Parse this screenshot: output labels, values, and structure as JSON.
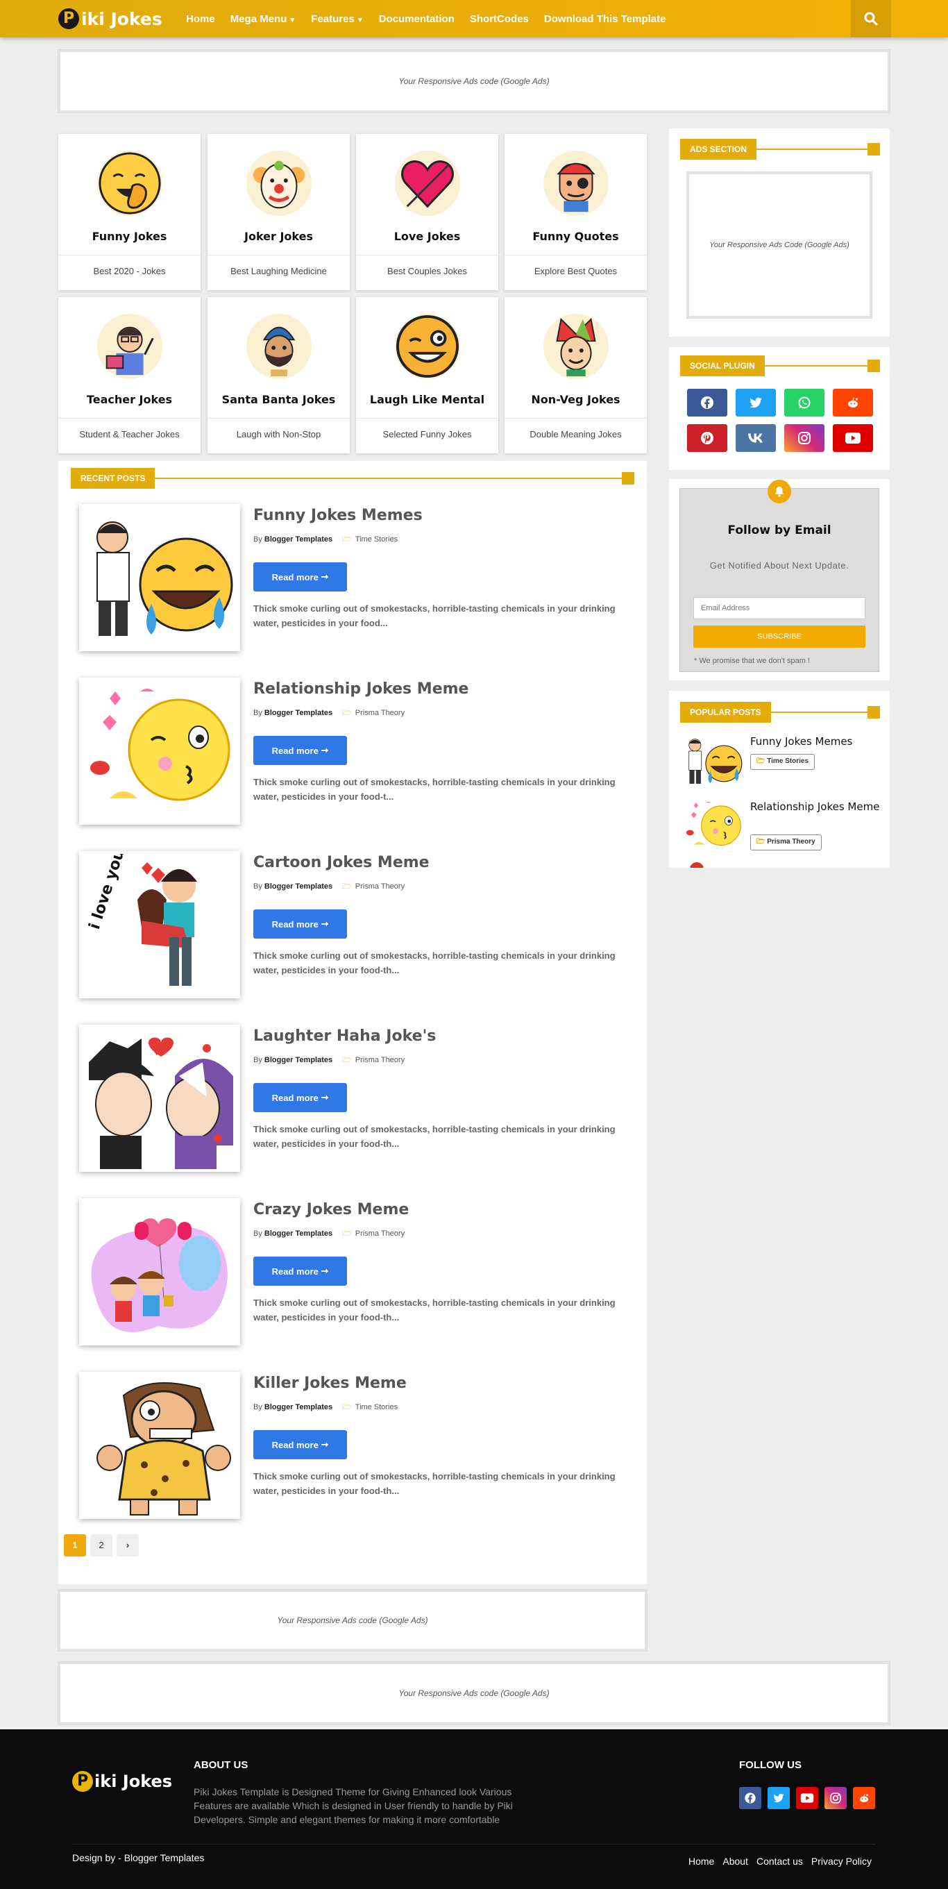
{
  "header": {
    "logo": "Piki Jokes",
    "logo_letter": "P",
    "logo_rest": "iki Jokes",
    "nav": [
      "Home",
      "Mega Menu",
      "Features",
      "Documentation",
      "ShortCodes",
      "Download This Template"
    ],
    "search_icon": "search-icon"
  },
  "ads": {
    "top": "Your Responsive Ads code (Google Ads)",
    "sidebar": "Your Responsive Ads Code (Google Ads)",
    "bottom_main": "Your Responsive Ads code (Google Ads)",
    "bottom_full": "Your Responsive Ads code (Google Ads)"
  },
  "categories": [
    {
      "title": "Funny Jokes",
      "sub": "Best 2020 - Jokes",
      "icon": "laughing-face-icon"
    },
    {
      "title": "Joker Jokes",
      "sub": "Best Laughing Medicine",
      "icon": "clown-icon"
    },
    {
      "title": "Love Jokes",
      "sub": "Best Couples Jokes",
      "icon": "heart-icon"
    },
    {
      "title": "Funny Quotes",
      "sub": "Explore Best Quotes",
      "icon": "pirate-icon"
    },
    {
      "title": "Teacher Jokes",
      "sub": "Student & Teacher Jokes",
      "icon": "teacher-icon"
    },
    {
      "title": "Santa Banta Jokes",
      "sub": "Laugh with Non-Stop",
      "icon": "sikh-man-icon"
    },
    {
      "title": "Laugh Like Mental",
      "sub": "Selected Funny Jokes",
      "icon": "winking-face-icon"
    },
    {
      "title": "Non-Veg Jokes",
      "sub": "Double Meaning Jokes",
      "icon": "jester-icon"
    }
  ],
  "recent": {
    "label": "RECENT POSTS",
    "by": "By",
    "author": "Blogger Templates",
    "read_more": "Read more",
    "posts": [
      {
        "title": "Funny Jokes Memes",
        "label": "Time Stories",
        "excerpt": "Thick smoke curling out of smokestacks, horrible-tasting chemicals in your drinking water, pesticides in your food..."
      },
      {
        "title": "Relationship Jokes Meme",
        "label": "Prisma Theory",
        "excerpt": "Thick smoke curling out of smokestacks, horrible-tasting chemicals in your drinking water, pesticides in your food-t..."
      },
      {
        "title": "Cartoon Jokes Meme",
        "label": "Prisma Theory",
        "excerpt": "Thick smoke curling out of smokestacks, horrible-tasting chemicals in your drinking water, pesticides in your food-th..."
      },
      {
        "title": "Laughter Haha Joke's",
        "label": "Prisma Theory",
        "excerpt": "Thick smoke curling out of smokestacks, horrible-tasting chemicals in your drinking water, pesticides in your food-th..."
      },
      {
        "title": "Crazy Jokes Meme",
        "label": "Prisma Theory",
        "excerpt": "Thick smoke curling out of smokestacks, horrible-tasting chemicals in your drinking water, pesticides in your food-th..."
      },
      {
        "title": "Killer Jokes Meme",
        "label": "Time Stories",
        "excerpt": "Thick smoke curling out of smokestacks, horrible-tasting chemicals in your drinking water, pesticides in your food-th..."
      }
    ],
    "pages": [
      "1",
      "2"
    ],
    "next": "›"
  },
  "sidebar": {
    "ads_label": "ADS SECTION",
    "social_label": "SOCIAL PLUGIN",
    "social": [
      {
        "name": "facebook-icon",
        "glyph": "f",
        "color": "#3b5998"
      },
      {
        "name": "twitter-icon",
        "glyph": "t",
        "color": "#1da1f2"
      },
      {
        "name": "whatsapp-icon",
        "glyph": "w",
        "color": "#25d366"
      },
      {
        "name": "reddit-icon",
        "glyph": "r",
        "color": "#ff4500"
      },
      {
        "name": "pinterest-icon",
        "glyph": "p",
        "color": "#cb2027"
      },
      {
        "name": "vk-icon",
        "glyph": "vk",
        "color": "#4c75a3"
      },
      {
        "name": "instagram-icon",
        "glyph": "ig",
        "color": "#c13584"
      },
      {
        "name": "youtube-icon",
        "glyph": "yt",
        "color": "#e00000"
      }
    ],
    "follow": {
      "title": "Follow by Email",
      "sub": "Get Notified About Next Update.",
      "placeholder": "Email Address",
      "button": "SUBSCRIBE",
      "note": "* We promise that we don't spam !"
    },
    "popular_label": "POPULAR POSTS",
    "popular": [
      {
        "title": "Funny Jokes Memes",
        "label": "Time Stories"
      },
      {
        "title": "Relationship Jokes Meme",
        "label": "Prisma Theory"
      }
    ]
  },
  "footer": {
    "logo": "Piki Jokes",
    "about_title": "ABOUT US",
    "about_text": "Piki Jokes Template is Designed Theme for Giving Enhanced look Various Features are available Which is designed in User friendly to handle by Piki Developers. Simple and elegant themes for making it more comfortable",
    "follow_title": "FOLLOW US",
    "credit": "Design by - Blogger Templates",
    "links": [
      "Home",
      "About",
      "Contact us",
      "Privacy Policy"
    ]
  },
  "colors": {
    "accent": "#e4ac0a",
    "button": "#2f78e6",
    "footer": "#0b0b0b"
  }
}
